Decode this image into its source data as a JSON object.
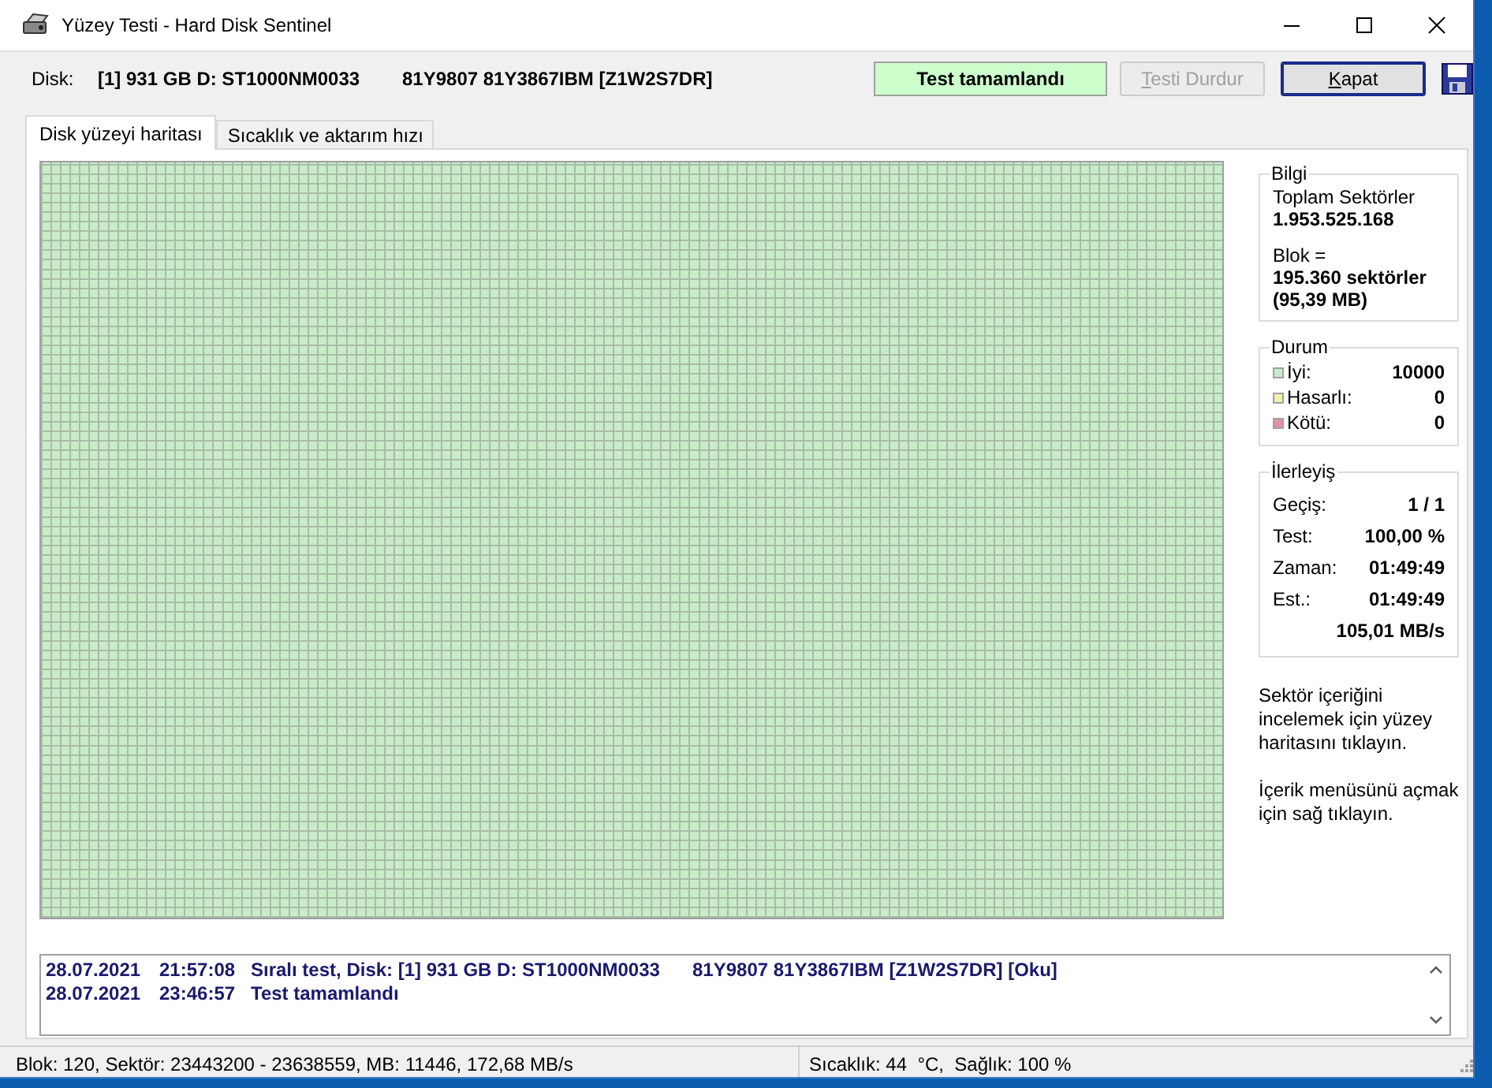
{
  "window": {
    "title": "Yüzey Testi - Hard Disk Sentinel"
  },
  "disk_bar": {
    "label": "Disk:",
    "disk": "[1] 931 GB D: ST1000NM0033",
    "serial": "81Y9807 81Y3867IBM [Z1W2S7DR]",
    "status": "Test tamamlandı",
    "buttons": [
      {
        "label": "Testi Durdur",
        "disabled": true,
        "default": false
      },
      {
        "label": "Kapat",
        "disabled": false,
        "default": true
      }
    ]
  },
  "tabs": [
    {
      "label": "Disk yüzeyi haritası",
      "selected": true
    },
    {
      "label": "Sıcaklık ve aktarım hızı",
      "selected": false
    }
  ],
  "info": {
    "title": "Bilgi",
    "total_label": "Toplam Sektörler",
    "total": "1.953.525.168",
    "block_label": "Blok =",
    "block_sectors": "195.360 sektörler",
    "block_size": "(95,39 MB)"
  },
  "status": {
    "title": "Durum",
    "items": [
      {
        "label": "İyi:",
        "value": "10000",
        "color": "#c8ecc8"
      },
      {
        "label": "Hasarlı:",
        "value": "0",
        "color": "#f0f0a8"
      },
      {
        "label": "Kötü:",
        "value": "0",
        "color": "#e8909c"
      }
    ]
  },
  "progress": {
    "title": "İlerleyiş",
    "rows": [
      {
        "label": "Geçiş:",
        "value": "1 / 1"
      },
      {
        "label": "Test:",
        "value": "100,00 %"
      },
      {
        "label": "Zaman:",
        "value": "01:49:49"
      },
      {
        "label": "Est.:",
        "value": "01:49:49"
      }
    ],
    "speed": "105,01 MB/s"
  },
  "hints": [
    "Sektör içeriğini incelemek için yüzey haritasını tıklayın.",
    "İçerik menüsünü açmak için sağ tıklayın."
  ],
  "log": [
    {
      "date": "28.07.2021",
      "time": "21:57:08",
      "message": "Sıralı test, Disk: [1] 931 GB D: ST1000NM0033",
      "detail": "81Y9807 81Y3867IBM [Z1W2S7DR] [Oku]"
    },
    {
      "date": "28.07.2021",
      "time": "23:46:57",
      "message": "Test tamamlandı"
    }
  ],
  "status_bar": {
    "left": "Blok: 120, Sektör: 23443200 - 23638559, MB: 11446, 172,68 MB/s",
    "right": "Sıcaklık: 44  °C,  Sağlık: 100 %"
  }
}
